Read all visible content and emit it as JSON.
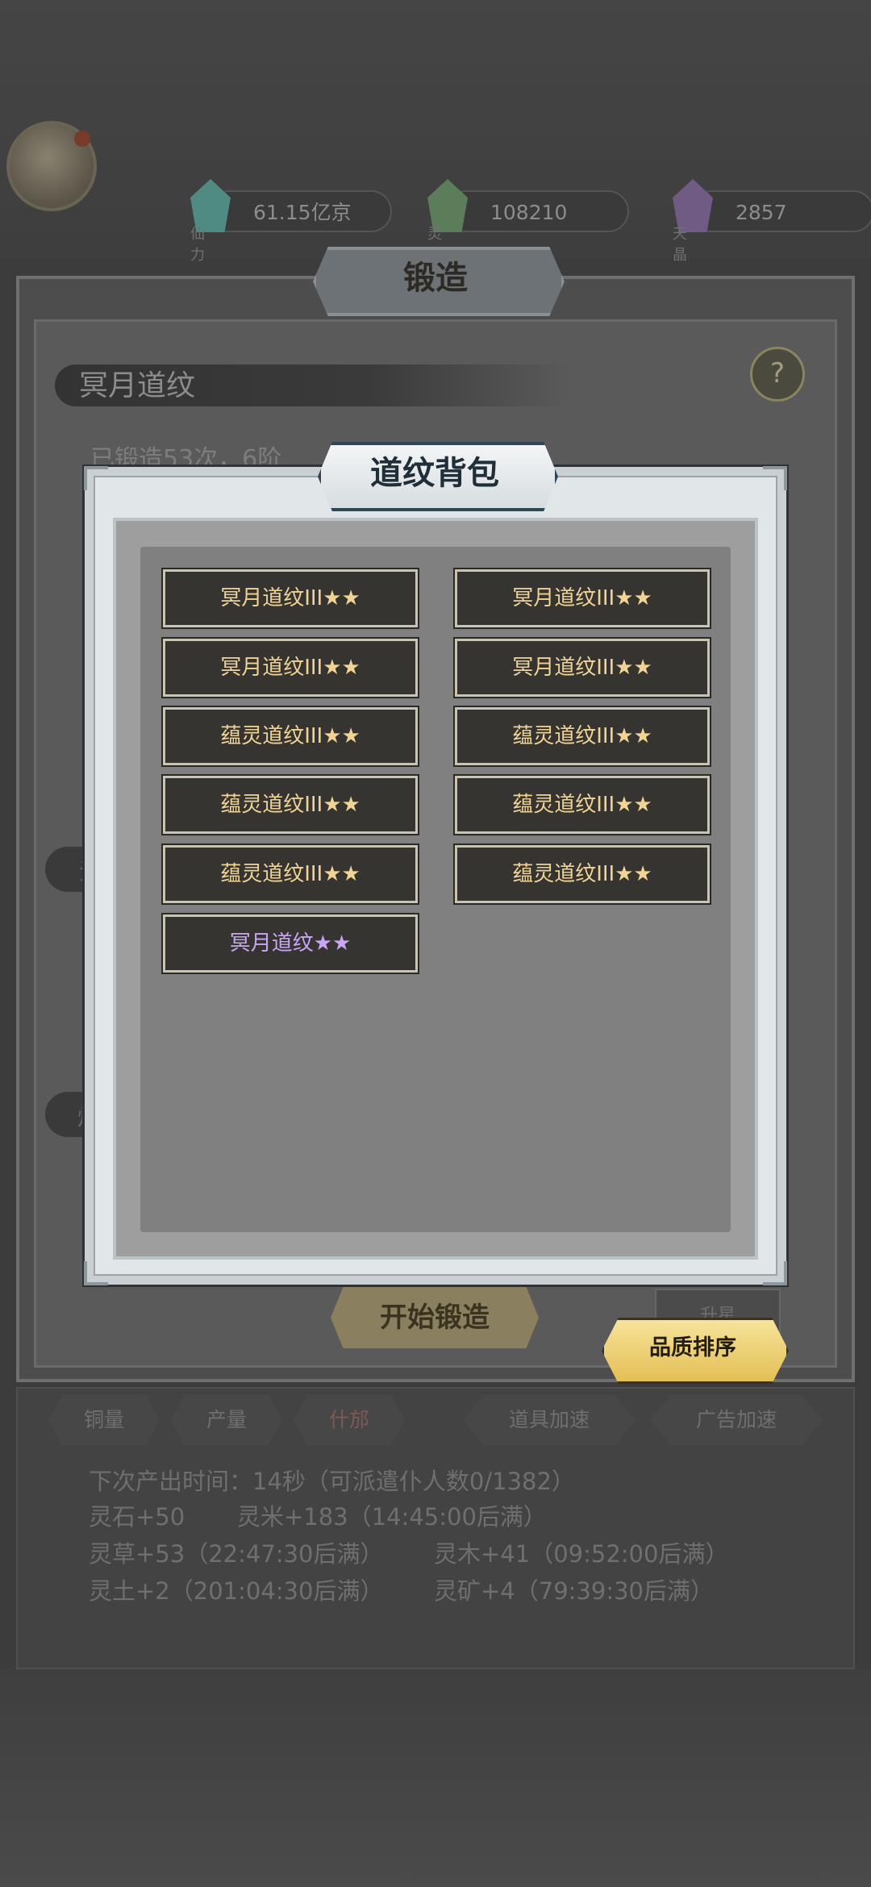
{
  "resources": [
    {
      "label": "仙力",
      "value": "61.15亿京",
      "icon": "teal-crystal-icon",
      "color": "#4f8a83"
    },
    {
      "label": "灵石",
      "value": "108210",
      "icon": "green-crystal-icon",
      "color": "#5c7d5a"
    },
    {
      "label": "天晶",
      "value": "2857",
      "icon": "purple-crystal-icon",
      "color": "#6f5b83"
    }
  ],
  "forge": {
    "title": "锻造",
    "recipe_name": "冥月道纹",
    "help": "?",
    "forged_info": "已锻造53次，6阶",
    "start_button": "开始锻造",
    "upgrade_button": "升星",
    "side_tab_1": "法",
    "side_tab_2": "炉"
  },
  "quality_sort_button": "品质排序",
  "bottom_tabs": [
    {
      "label": "铜量"
    },
    {
      "label": "产量"
    },
    {
      "label": "什邡"
    },
    {
      "label": "道具加速"
    },
    {
      "label": "广告加速"
    }
  ],
  "info": {
    "next_output": "下次产出时间：14秒（可派遣仆人数0/1382）",
    "stone": "灵石+50",
    "rice": "灵米+183（14:45:00后满）",
    "herb": "灵草+53（22:47:30后满）",
    "wood": "灵木+41（09:52:00后满）",
    "soil": "灵土+2（201:04:30后满）",
    "ore": "灵矿+4（79:39:30后满）"
  },
  "bag": {
    "title": "道纹背包",
    "items": [
      {
        "label": "冥月道纹III★★",
        "quality": "gold"
      },
      {
        "label": "冥月道纹III★★",
        "quality": "gold"
      },
      {
        "label": "冥月道纹III★★",
        "quality": "gold"
      },
      {
        "label": "冥月道纹III★★",
        "quality": "gold"
      },
      {
        "label": "蕴灵道纹III★★",
        "quality": "gold"
      },
      {
        "label": "蕴灵道纹III★★",
        "quality": "gold"
      },
      {
        "label": "蕴灵道纹III★★",
        "quality": "gold"
      },
      {
        "label": "蕴灵道纹III★★",
        "quality": "gold"
      },
      {
        "label": "蕴灵道纹III★★",
        "quality": "gold"
      },
      {
        "label": "蕴灵道纹III★★",
        "quality": "gold"
      },
      {
        "label": "冥月道纹★★",
        "quality": "purple"
      }
    ]
  }
}
